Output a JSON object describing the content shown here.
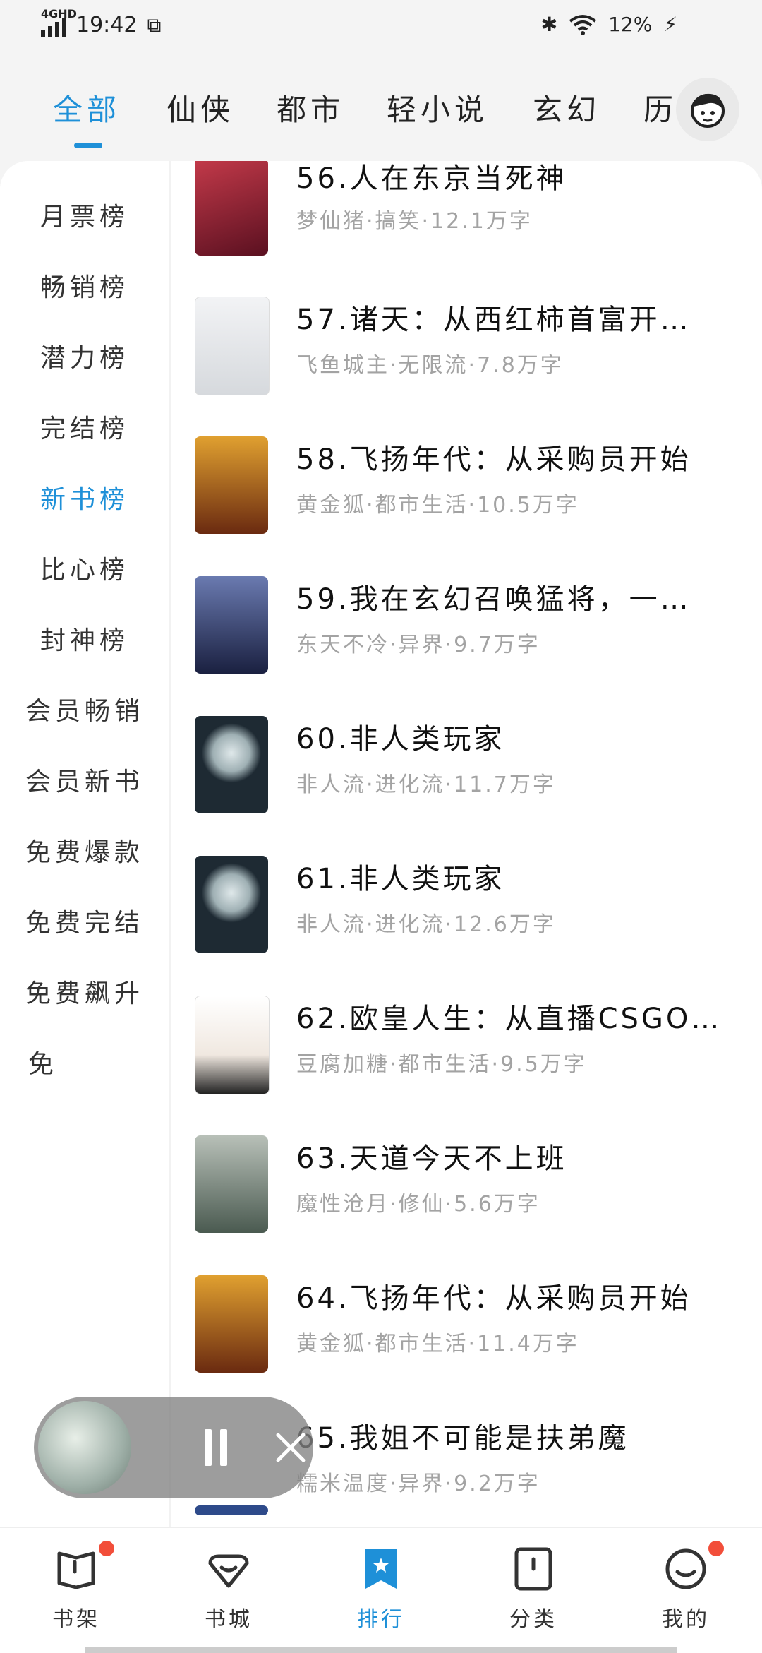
{
  "status_bar": {
    "network": "4GHD",
    "time": "19:42",
    "battery": "12%"
  },
  "top_tabs": [
    "全部",
    "仙侠",
    "都市",
    "轻小说",
    "玄幻",
    "历"
  ],
  "sidebar": [
    "月票榜",
    "畅销榜",
    "潜力榜",
    "完结榜",
    "新书榜",
    "比心榜",
    "封神榜",
    "会员畅销",
    "会员新书",
    "免费爆款",
    "免费完结",
    "免费飙升",
    "免"
  ],
  "books": [
    {
      "title": "56.人在东京当死神",
      "meta": "梦仙猪·搞笑·12.1万字",
      "cover_color": "#8a2030"
    },
    {
      "title": "57.诸天：从西红柿首富开…",
      "meta": "飞鱼城主·无限流·7.8万字",
      "cover_color": "#e6e8ea"
    },
    {
      "title": "58.飞扬年代：从采购员开始",
      "meta": "黄金狐·都市生活·10.5万字",
      "cover_color": "#b8741e"
    },
    {
      "title": "59.我在玄幻召唤猛将，一…",
      "meta": "东天不冷·异界·9.7万字",
      "cover_color": "#3a4a7a"
    },
    {
      "title": "60.非人类玩家",
      "meta": "非人流·进化流·11.7万字",
      "cover_color": "#1e2a33"
    },
    {
      "title": "61.非人类玩家",
      "meta": "非人流·进化流·12.6万字",
      "cover_color": "#1e2a33"
    },
    {
      "title": "62.欧皇人生：从直播CSGO…",
      "meta": "豆腐加糖·都市生活·9.5万字",
      "cover_color": "#f4f4f4"
    },
    {
      "title": "63.天道今天不上班",
      "meta": "魔性沧月·修仙·5.6万字",
      "cover_color": "#6e7a70"
    },
    {
      "title": "64.飞扬年代：从采购员开始",
      "meta": "黄金狐·都市生活·11.4万字",
      "cover_color": "#b8741e"
    },
    {
      "title": "65.我姐不可能是扶弟魔",
      "meta": "糯米温度·异界·9.2万字",
      "cover_color": "#2e4a8a"
    }
  ],
  "bottom_nav": [
    "书架",
    "书城",
    "排行",
    "分类",
    "我的"
  ],
  "colors": {
    "accent": "#1e90d8",
    "badge": "#f24e3a"
  }
}
